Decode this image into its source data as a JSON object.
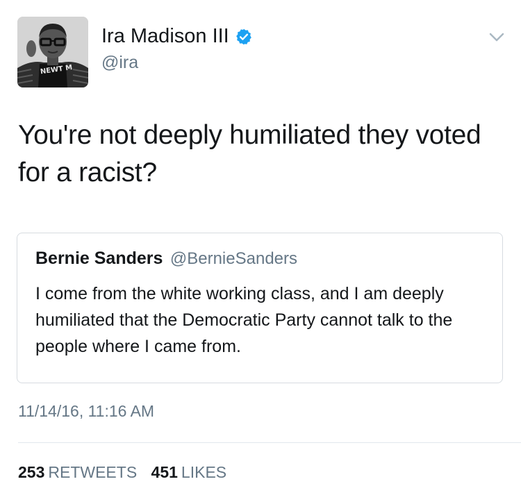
{
  "author": {
    "display_name": "Ira Madison III",
    "handle": "@ira",
    "verified": true,
    "avatar_shirt_text": "NEWT M"
  },
  "tweet": {
    "text": "You're not deeply humiliated they voted for a racist?",
    "timestamp": "11/14/16, 11:16 AM"
  },
  "quoted_tweet": {
    "display_name": "Bernie Sanders",
    "handle": "@BernieSanders",
    "text": "I come from the white working class, and I am deeply humiliated that the Democratic Party cannot talk to the people where I came from."
  },
  "stats": {
    "retweets_count": "253",
    "retweets_label": "RETWEETS",
    "likes_count": "451",
    "likes_label": "LIKES"
  },
  "colors": {
    "verified_blue": "#1da1f2",
    "secondary_text": "#657786",
    "primary_text": "#14171a",
    "border": "#d6dbe0"
  },
  "icons": {
    "verified": "verified-badge-icon",
    "menu": "chevron-down-icon"
  }
}
